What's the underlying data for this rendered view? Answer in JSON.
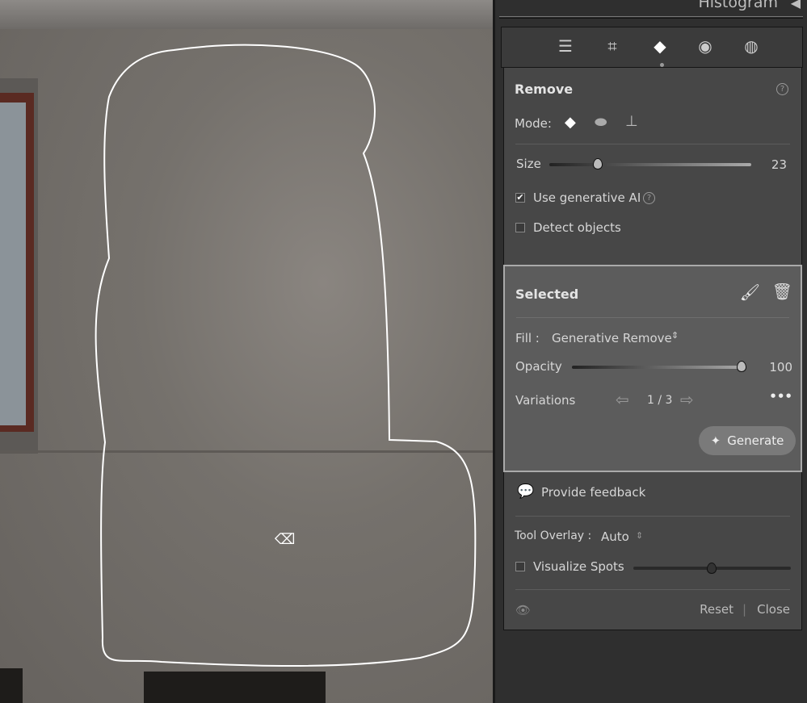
{
  "header": {
    "title": "Histogram",
    "collapse_icon": "triangle-left-icon"
  },
  "tools": [
    "edit-sliders-icon",
    "crop-icon",
    "remove-eraser-icon",
    "red-eye-icon",
    "masking-icon"
  ],
  "remove": {
    "title": "Remove",
    "mode_label": "Mode:",
    "modes": [
      "remove-icon",
      "heal-icon",
      "clone-icon"
    ],
    "size_label": "Size",
    "size_value": "23",
    "size_fraction": 0.23,
    "gen_ai_label": "Use generative AI",
    "gen_ai_checked": true,
    "detect_label": "Detect objects",
    "detect_checked": false
  },
  "selected": {
    "title": "Selected",
    "fill_label": "Fill :",
    "fill_value": "Generative Remove",
    "opacity_label": "Opacity",
    "opacity_value": "100",
    "variations_label": "Variations",
    "variations_value": "1 / 3",
    "generate_label": "Generate"
  },
  "feedback": {
    "label": "Provide feedback"
  },
  "overlay": {
    "label": "Tool Overlay :",
    "value": "Auto",
    "visualize_label": "Visualize Spots",
    "visualize_checked": false,
    "visualize_fraction": 0.5
  },
  "footer": {
    "reset": "Reset",
    "sep": "|",
    "close": "Close"
  }
}
